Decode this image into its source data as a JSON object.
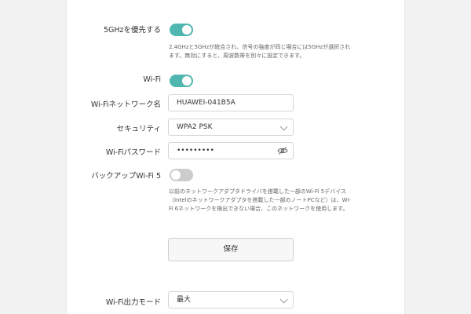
{
  "prefer_5g": {
    "label": "5GHzを優先する",
    "state": "on",
    "description": "2.4GHzと5GHzが統合され、信号の強度が同じ場合には5GHzが選択されます。無効にすると、周波数帯を別々に設定できます。"
  },
  "wifi": {
    "label": "Wi-Fi",
    "state": "on"
  },
  "ssid": {
    "label": "Wi-Fiネットワーク名",
    "value": "HUAWEI-041B5A"
  },
  "security": {
    "label": "セキュリティ",
    "selected": "WPA2 PSK"
  },
  "password": {
    "label": "Wi-Fiパスワード",
    "value": "•••••••••"
  },
  "backup_wifi5": {
    "label": "バックアップWi-Fi 5",
    "state": "off",
    "description": "以前のネットワークアダプタドライバを搭載した一部のWi-Fi 5デバイス（Intelのネットワークアダプタを搭載した一部のノートPCなど）は、Wi-Fi 6ネットワークを検出できない場合、このネットワークを使用します。"
  },
  "save_button": {
    "label": "保存"
  },
  "output_mode": {
    "label": "Wi-Fi出力モード",
    "selected": "最大"
  },
  "colors": {
    "toggle_on": "#4fb6b0",
    "toggle_off": "#cccccc"
  }
}
